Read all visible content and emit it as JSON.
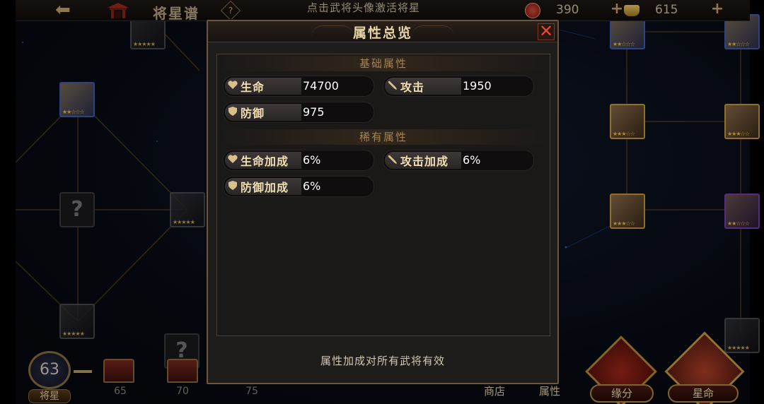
{
  "topbar": {
    "title": "将星谱",
    "help": "?",
    "hint": "点击武将头像激活将星",
    "resource1_value": "390",
    "resource2_value": "615",
    "plus": "+"
  },
  "background": {
    "level": "63",
    "level_label": "将星",
    "chests": [
      "65",
      "70",
      "75"
    ],
    "unknown_mark": "?",
    "bottom_nav": {
      "shop": "商店",
      "attributes": "属性",
      "fate": "缘分",
      "destiny": "星命"
    },
    "colors": {
      "accent_gold": "#c99a3a",
      "accent_red": "#a0281c"
    }
  },
  "modal": {
    "title": "属性总览",
    "close": "✕",
    "basic_section": "基础属性",
    "basic_stats": [
      {
        "label": "生命",
        "value": "74700",
        "icon": "heart-icon"
      },
      {
        "label": "攻击",
        "value": "1950",
        "icon": "sword-icon"
      },
      {
        "label": "防御",
        "value": "975",
        "icon": "shield-icon"
      }
    ],
    "rare_section": "稀有属性",
    "rare_stats": [
      {
        "label": "生命加成",
        "value": "6%",
        "icon": "heart-icon"
      },
      {
        "label": "攻击加成",
        "value": "6%",
        "icon": "sword-icon"
      },
      {
        "label": "防御加成",
        "value": "6%",
        "icon": "shield-icon"
      }
    ],
    "footer": "属性加成对所有武将有效"
  }
}
